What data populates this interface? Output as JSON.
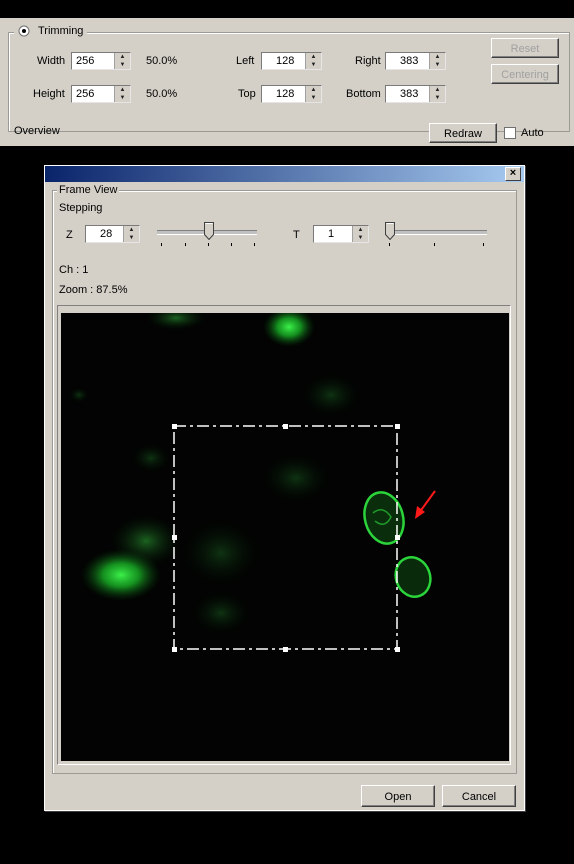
{
  "trimming": {
    "radio_label": "Trimming",
    "width_label": "Width",
    "width_value": "256",
    "width_percent": "50.0%",
    "height_label": "Height",
    "height_value": "256",
    "height_percent": "50.0%",
    "left_label": "Left",
    "left_value": "128",
    "top_label": "Top",
    "top_value": "128",
    "right_label": "Right",
    "right_value": "383",
    "bottom_label": "Bottom",
    "bottom_value": "383",
    "reset_label": "Reset",
    "centering_label": "Centering"
  },
  "overview": {
    "label": "Overview",
    "redraw_label": "Redraw",
    "auto_label": "Auto"
  },
  "dialog": {
    "close_glyph": "×",
    "frame_view_label": "Frame View",
    "stepping_label": "Stepping",
    "z_label": "Z",
    "z_value": "28",
    "t_label": "T",
    "t_value": "1",
    "channel_text": "Ch : 1",
    "zoom_text": "Zoom : 87.5%",
    "open_label": "Open",
    "cancel_label": "Cancel"
  },
  "colors": {
    "panel": "#d4d0c8",
    "cell_green": "#2bd43a",
    "annotation_arrow": "#ff1a1a",
    "selection_box": "#ffffff"
  },
  "icons": {
    "radio": "radio-selected-icon",
    "checkbox": "checkbox-unchecked-icon",
    "arrow": "red-arrow-icon"
  }
}
